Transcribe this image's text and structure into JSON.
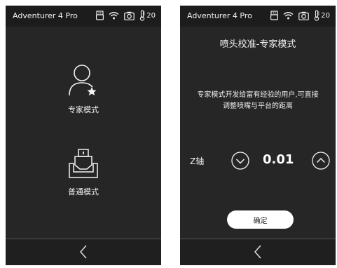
{
  "left_screen": {
    "status_bar": {
      "title": "Adventurer 4 Pro",
      "temperature": "20"
    },
    "modes": [
      {
        "label": "专家模式",
        "icon": "user-star-icon"
      },
      {
        "label": "普通模式",
        "icon": "print-bed-icon"
      }
    ]
  },
  "right_screen": {
    "status_bar": {
      "title": "Adventurer 4 Pro",
      "temperature": "20"
    },
    "title": "喷头校准-专家模式",
    "description_line1": "专家模式开发给富有经验的用户,可直接",
    "description_line2": "调整喷嘴与平台的距离",
    "axis_label": "Z轴",
    "offset_value": "0.01",
    "confirm_label": "确定"
  },
  "colors": {
    "screen_bg": "#262626",
    "status_bg": "#1c1c1c",
    "text": "#f2f2f2",
    "button_bg": "#ffffff"
  }
}
